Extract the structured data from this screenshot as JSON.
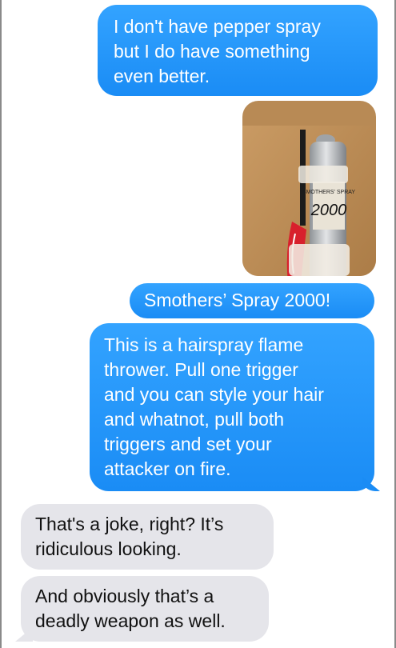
{
  "conversation": {
    "messages": [
      {
        "sender": "me",
        "type": "text",
        "text": "I don't have pepper spray\nbut I do have something\neven better."
      },
      {
        "sender": "me",
        "type": "image",
        "image_text": [
          "SMOTHERS' SPRAY",
          "2000"
        ]
      },
      {
        "sender": "me",
        "type": "text",
        "text": "Smothers’ Spray 2000!"
      },
      {
        "sender": "me",
        "type": "text",
        "text": "This is a hairspray flame\nthrower. Pull one trigger\nand you can style your hair\nand whatnot, pull both\ntriggers and set your\nattacker on fire."
      },
      {
        "sender": "them",
        "type": "text",
        "text": "That's a joke, right? It’s\nridiculous looking."
      },
      {
        "sender": "them",
        "type": "text",
        "text": "And obviously that’s a\ndeadly weapon as well."
      }
    ]
  },
  "colors": {
    "sent_bubble": "#1a8cf5",
    "received_bubble": "#e5e5ea",
    "background": "#ffffff"
  }
}
